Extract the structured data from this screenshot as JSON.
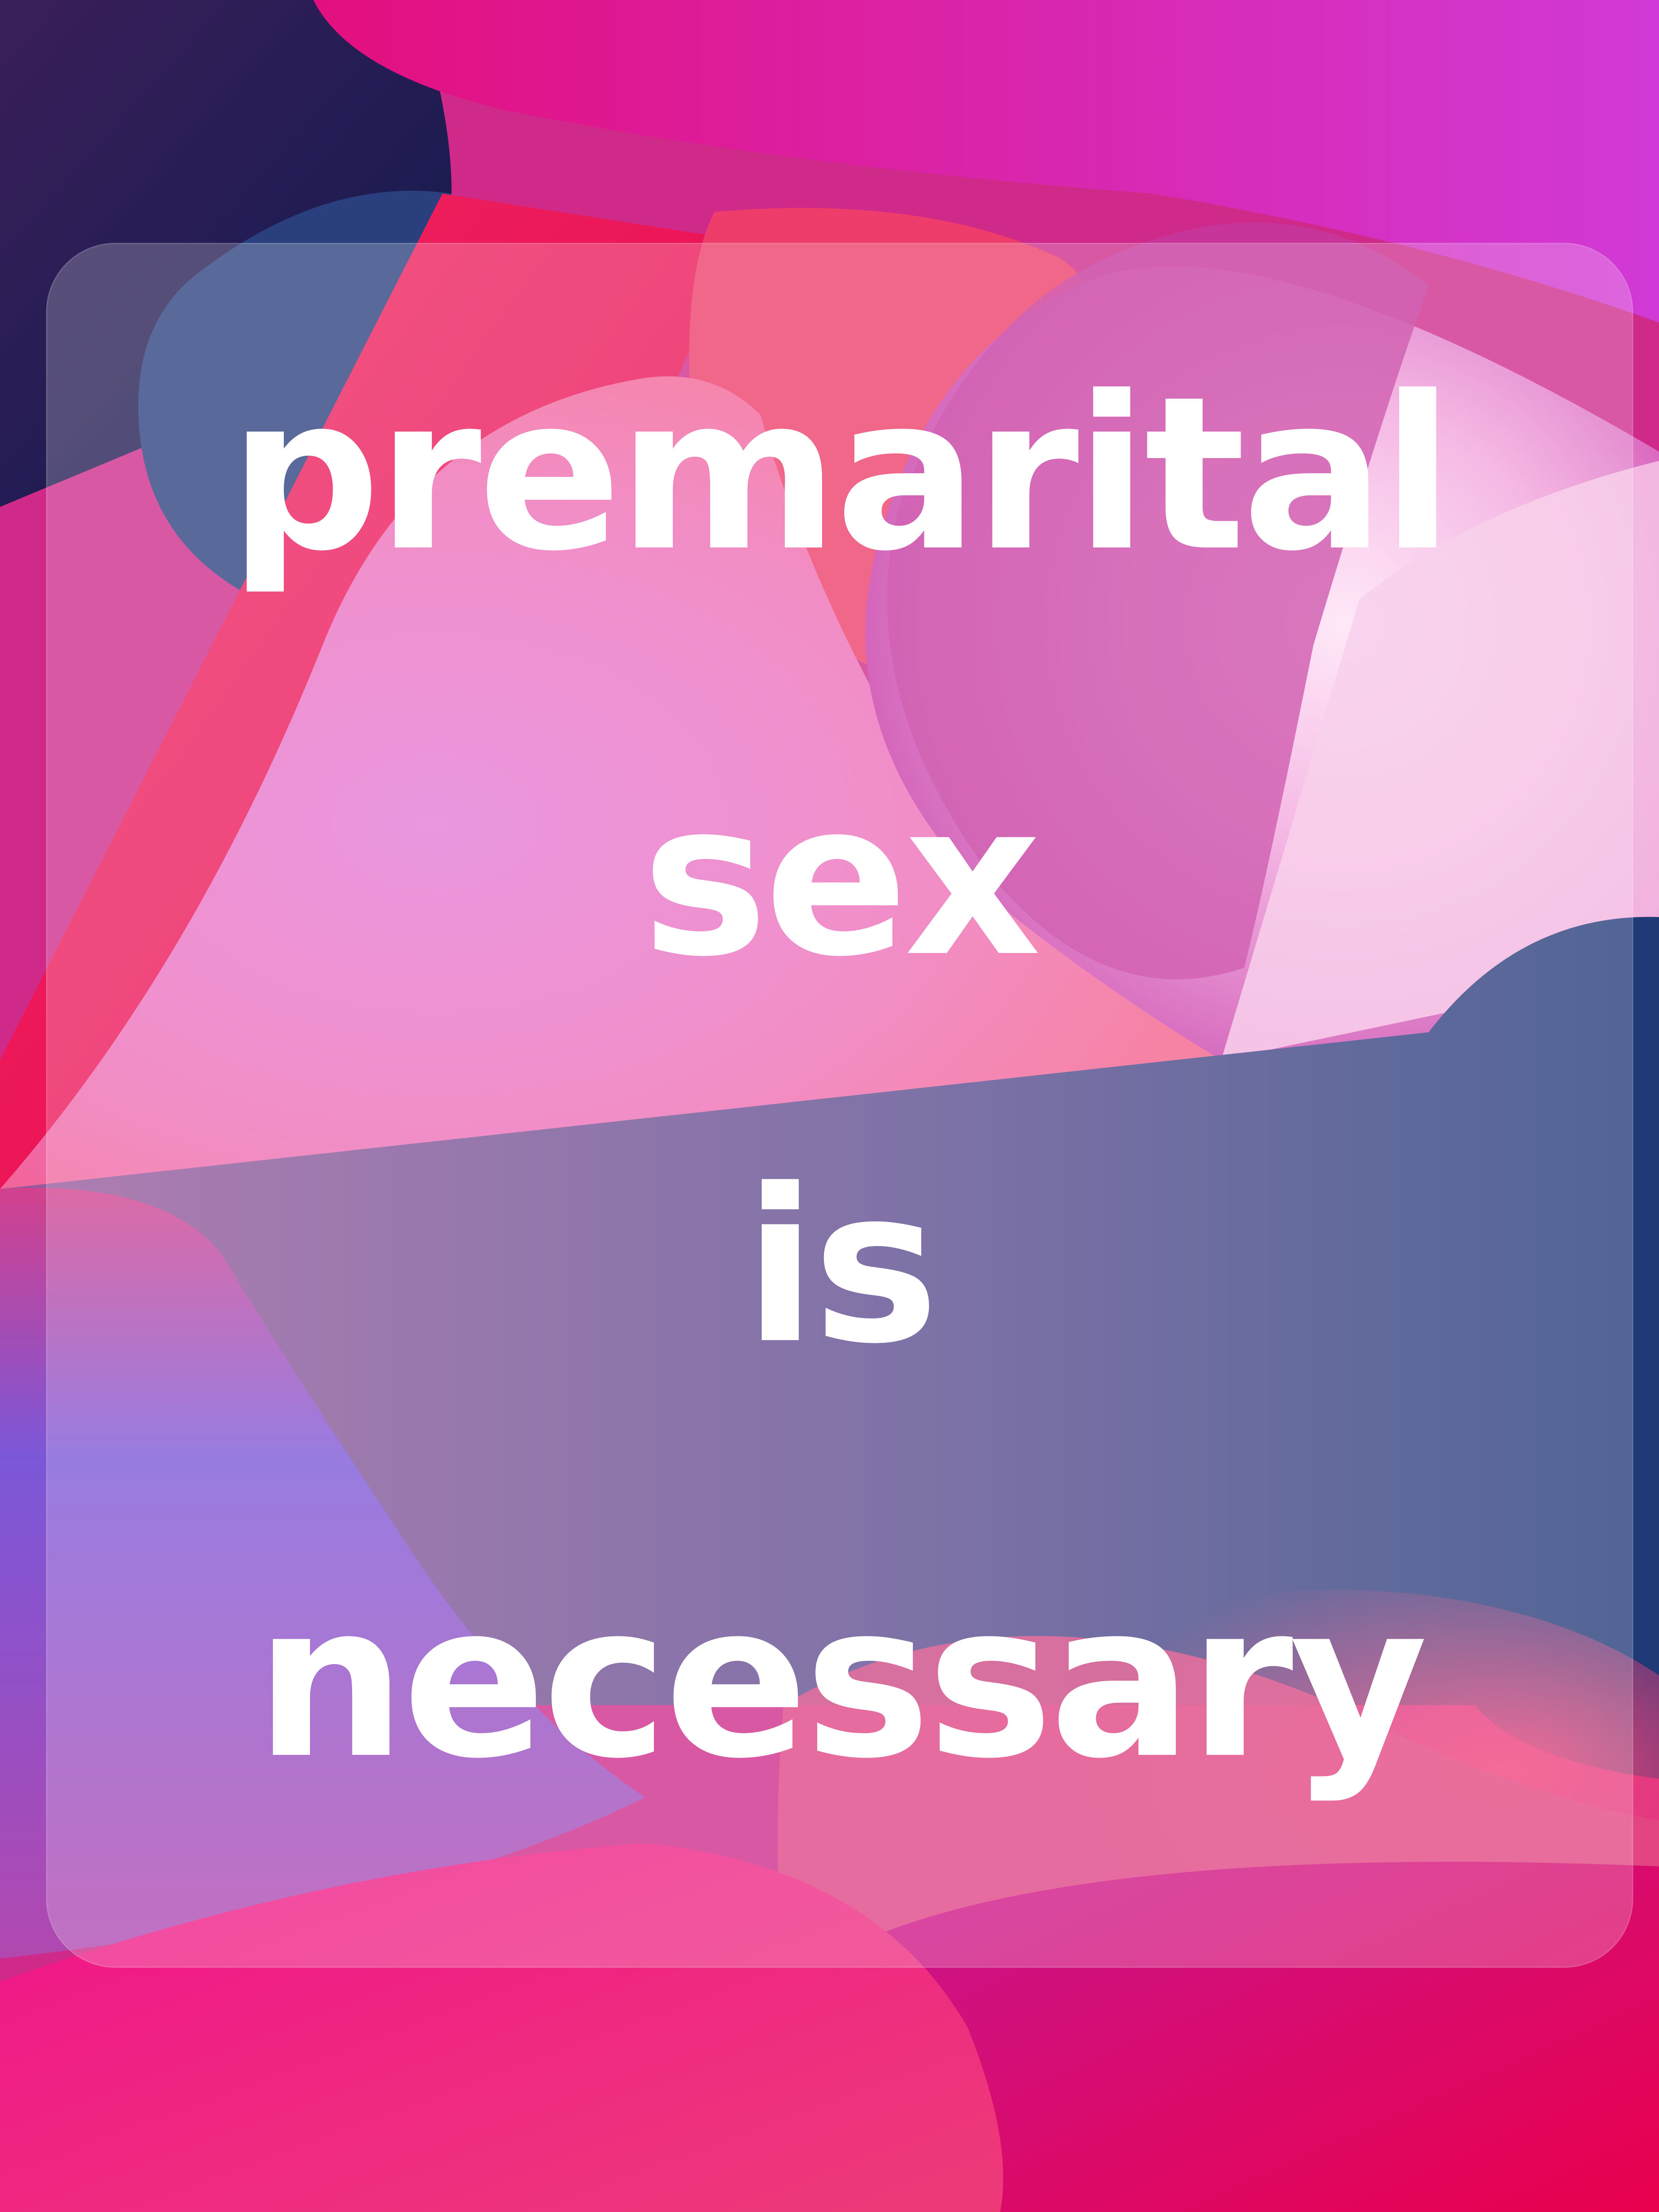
{
  "poster": {
    "lines": [
      "premarital",
      "sex",
      "is",
      "necessary"
    ]
  },
  "colors": {
    "text": "#ffffff",
    "magenta": "#f0138a",
    "hot_pink": "#e71e6b",
    "orchid": "#e47ad7",
    "navy": "#1f3977",
    "dark_navy": "#0e1a4d",
    "violet": "#7b57d8",
    "crimson": "#e8004d",
    "light_pink": "#f6c8e7"
  }
}
